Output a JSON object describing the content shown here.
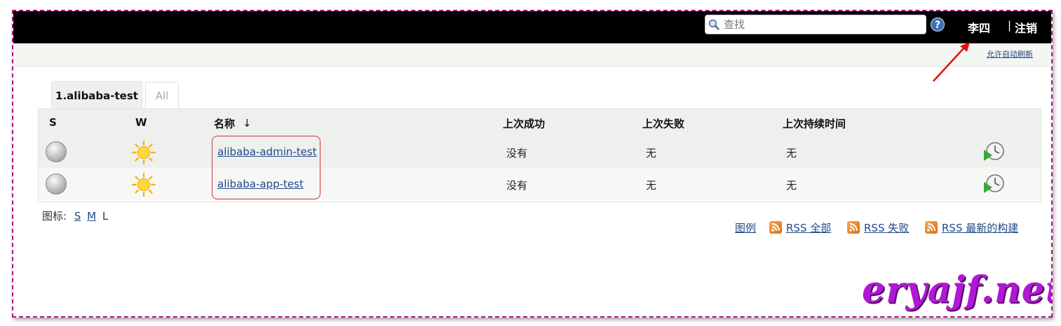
{
  "header": {
    "search_placeholder": "查找",
    "user": "李四",
    "separator": "|",
    "logout": "注销",
    "auto_refresh": "允许自动刷新"
  },
  "tabs": [
    {
      "label": "1.alibaba-test",
      "active": true
    },
    {
      "label": "All",
      "active": false
    }
  ],
  "table": {
    "columns": [
      "S",
      "W",
      "名称",
      "↓",
      "上次成功",
      "上次失败",
      "上次持续时间"
    ],
    "rows": [
      {
        "name": "alibaba-admin-test",
        "last_success": "没有",
        "last_failure": "无",
        "last_duration": "无",
        "status": "grey-ball",
        "weather": "sunny"
      },
      {
        "name": "alibaba-app-test",
        "last_success": "没有",
        "last_failure": "无",
        "last_duration": "无",
        "status": "grey-ball",
        "weather": "sunny"
      }
    ]
  },
  "icon_size": {
    "label": "图标:",
    "sizes": [
      "S",
      "M",
      "L"
    ]
  },
  "footer": {
    "legend": "图例",
    "rss_all": "RSS 全部",
    "rss_failed": "RSS 失败",
    "rss_latest": "RSS 最新的构建"
  },
  "watermark": "eryajf.net",
  "colors": {
    "topbar": "#000000",
    "link": "#204a87",
    "highlight": "#cc3333",
    "watermark": "#b118d6",
    "frame": "#b0127a"
  }
}
